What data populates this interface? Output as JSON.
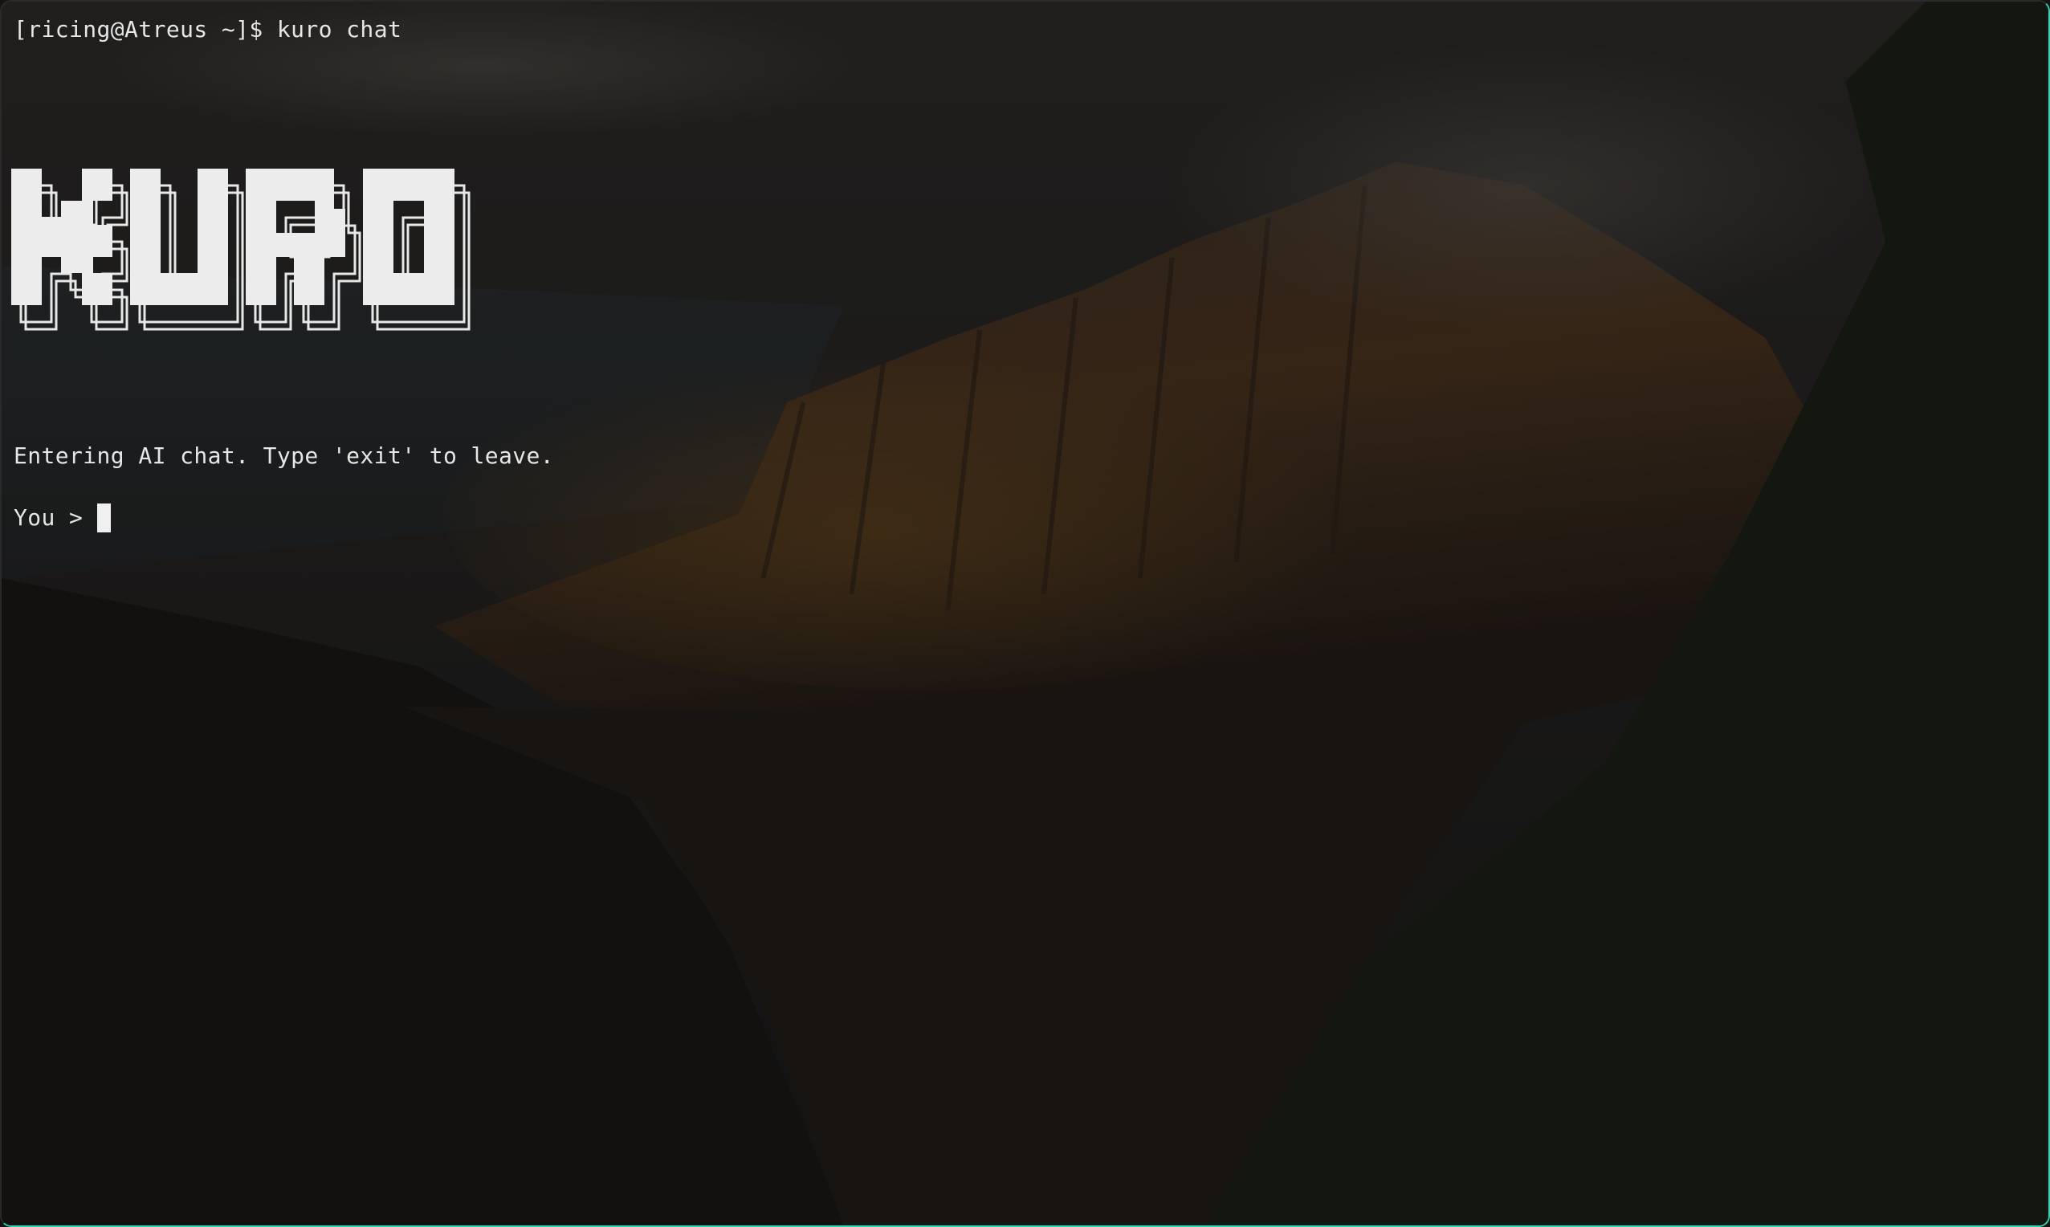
{
  "terminal": {
    "prompt": "[ricing@Atreus ~]$ kuro chat",
    "logo_text": "KURO",
    "info": "Entering AI chat. Type 'exit' to leave.",
    "input_label": "You >",
    "input_value": ""
  },
  "colors": {
    "accent_border": "#2fd6b3",
    "text": "#e6e6e6"
  },
  "background": {
    "subject": "dark mountain valley landscape wallpaper"
  }
}
